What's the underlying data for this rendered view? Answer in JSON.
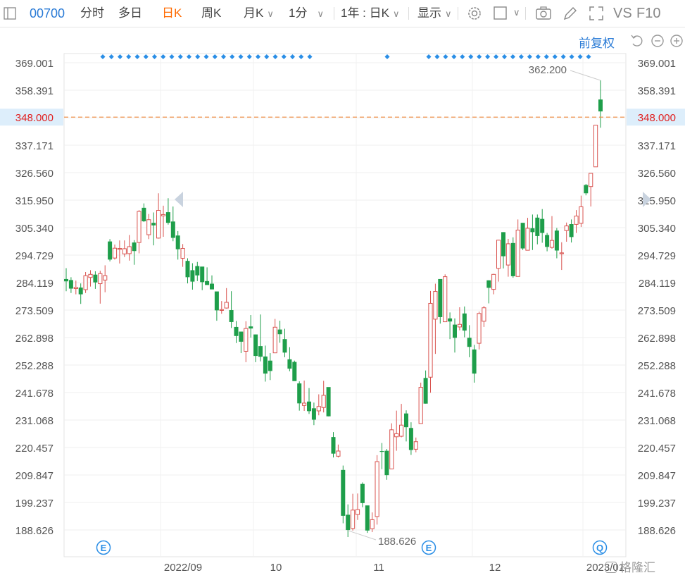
{
  "toolbar": {
    "stock_code": "00700",
    "tabs": [
      "分时",
      "多日",
      "日K",
      "周K",
      "月K",
      "1分"
    ],
    "active_tab": "日K",
    "range_select": "1年 : 日K",
    "display_select": "显示",
    "vs_label": "VS",
    "f10_label": "F10"
  },
  "adjust_label": "前复权",
  "chart_data": {
    "type": "candlestick",
    "y_ticks": [
      "369.001",
      "358.391",
      "348.000",
      "337.171",
      "326.560",
      "315.950",
      "305.340",
      "294.729",
      "284.119",
      "273.509",
      "262.898",
      "252.288",
      "241.678",
      "231.068",
      "220.457",
      "209.847",
      "199.237",
      "188.626"
    ],
    "ylim": [
      188.626,
      369.001
    ],
    "x_ticks": [
      "2022/09",
      "10",
      "11",
      "12",
      "2023/01"
    ],
    "current_price": "348.000",
    "high_label": "362.200",
    "low_label": "188.626",
    "up_color": "#d9534f",
    "down_color": "#1e9e4a",
    "current_line_color": "#f08a3c",
    "event_markers": [
      "E",
      "E",
      "Q"
    ],
    "candles": [
      [
        285.5,
        284.6,
        289.7,
        280.8
      ],
      [
        285.1,
        281.8,
        286.2,
        280.1
      ],
      [
        281.8,
        282.3,
        284.9,
        279.6
      ],
      [
        282.2,
        279.6,
        283.8,
        275.9
      ],
      [
        281.4,
        286.8,
        288.2,
        280.1
      ],
      [
        286.1,
        287.3,
        288.9,
        282.6
      ],
      [
        287.2,
        284.2,
        288.5,
        281.7
      ],
      [
        283.7,
        287.6,
        288.7,
        276.0
      ],
      [
        285.1,
        286.8,
        290.8,
        280.4
      ],
      [
        300.0,
        293.0,
        300.9,
        292.3
      ],
      [
        293.6,
        297.4,
        298.8,
        293.0
      ],
      [
        297.0,
        297.3,
        300.4,
        291.5
      ],
      [
        295.2,
        297.2,
        300.4,
        294.0
      ],
      [
        295.3,
        298.0,
        302.5,
        292.6
      ],
      [
        299.6,
        296.3,
        300.5,
        291.0
      ],
      [
        299.6,
        311.6,
        312.1,
        295.4
      ],
      [
        313.0,
        307.8,
        314.7,
        307.5
      ],
      [
        302.6,
        308.4,
        310.6,
        300.9
      ],
      [
        307.2,
        306.2,
        311.2,
        298.5
      ],
      [
        301.3,
        312.0,
        318.6,
        301.1
      ],
      [
        309.9,
        310.4,
        313.8,
        301.8
      ],
      [
        311.3,
        307.2,
        316.7,
        306.5
      ],
      [
        307.7,
        301.4,
        313.5,
        300.1
      ],
      [
        302.3,
        297.0,
        304.0,
        293.0
      ],
      [
        293.5,
        297.3,
        299.0,
        290.2
      ],
      [
        292.5,
        286.2,
        293.5,
        283.8
      ],
      [
        288.9,
        284.5,
        291.6,
        281.4
      ],
      [
        290.5,
        286.9,
        292.1,
        284.7
      ],
      [
        290.3,
        284.3,
        287.4,
        281.2
      ],
      [
        284.7,
        283.2,
        290.0,
        283.4
      ],
      [
        283.7,
        281.5,
        286.9,
        281.5
      ],
      [
        280.7,
        273.4,
        280.6,
        269.4
      ],
      [
        273.4,
        273.7,
        277.0,
        272.1
      ],
      [
        274.3,
        276.5,
        282.0,
        274.1
      ],
      [
        273.5,
        268.9,
        280.8,
        266.6
      ],
      [
        267.0,
        263.5,
        269.3,
        260.8
      ],
      [
        265.2,
        261.3,
        265.2,
        256.9
      ],
      [
        257.6,
        266.4,
        269.2,
        253.4
      ],
      [
        267.2,
        266.4,
        271.6,
        262.9
      ],
      [
        264.1,
        255.8,
        264.1,
        253.4
      ],
      [
        259.6,
        255.5,
        271.8,
        253.7
      ],
      [
        255.6,
        249.0,
        259.8,
        245.9
      ],
      [
        254.0,
        250.0,
        256.9,
        246.5
      ],
      [
        257.0,
        266.9,
        270.1,
        256.9
      ],
      [
        266.0,
        264.2,
        269.4,
        260.9
      ],
      [
        262.3,
        257.1,
        266.3,
        255.3
      ],
      [
        254.5,
        250.9,
        259.2,
        249.9
      ],
      [
        253.5,
        246.1,
        254.0,
        246.2
      ],
      [
        245.2,
        237.5,
        246.0,
        234.7
      ],
      [
        236.7,
        237.6,
        246.3,
        234.6
      ],
      [
        238.2,
        234.5,
        243.4,
        233.4
      ],
      [
        235.6,
        231.2,
        237.8,
        229.1
      ],
      [
        234.6,
        236.3,
        241.0,
        232.9
      ],
      [
        235.9,
        240.6,
        246.2,
        234.0
      ],
      [
        243.8,
        232.5,
        242.6,
        232.5
      ],
      [
        224.5,
        218.1,
        226.4,
        216.6
      ],
      [
        217.1,
        219.1,
        221.6,
        216.6
      ],
      [
        211.8,
        194.1,
        213.5,
        191.2
      ],
      [
        194.5,
        188.6,
        198.5,
        185.9
      ],
      [
        189.2,
        196.3,
        202.6,
        188.4
      ],
      [
        194.6,
        196.5,
        202.7,
        192.5
      ],
      [
        206.4,
        199.0,
        207.0,
        197.4
      ],
      [
        198.1,
        188.4,
        198.0,
        187.5
      ],
      [
        189.1,
        192.6,
        195.4,
        187.8
      ],
      [
        193.8,
        215.0,
        217.5,
        190.7
      ],
      [
        219.1,
        219.0,
        222.2,
        212.1
      ],
      [
        219.2,
        209.8,
        219.9,
        208.0
      ],
      [
        212.2,
        227.3,
        229.8,
        212.2
      ],
      [
        224.6,
        225.8,
        234.7,
        219.2
      ],
      [
        224.8,
        229.1,
        237.3,
        224.4
      ],
      [
        233.6,
        228.3,
        234.8,
        222.8
      ],
      [
        228.0,
        219.5,
        230.2,
        217.6
      ],
      [
        219.8,
        222.7,
        224.3,
        218.6
      ],
      [
        229.7,
        243.7,
        245.5,
        229.7
      ],
      [
        247.3,
        237.4,
        250.2,
        237.4
      ],
      [
        247.6,
        276.1,
        280.9,
        241.6
      ],
      [
        270.0,
        280.7,
        283.7,
        256.6
      ],
      [
        285.5,
        270.8,
        281.9,
        268.3
      ],
      [
        269.0,
        286.4,
        287.3,
        271.1
      ],
      [
        270.3,
        269.1,
        272.6,
        262.3
      ],
      [
        267.9,
        262.8,
        270.3,
        257.1
      ],
      [
        267.0,
        268.0,
        274.6,
        265.7
      ],
      [
        272.2,
        265.6,
        274.9,
        263.0
      ],
      [
        262.8,
        259.3,
        267.7,
        255.3
      ],
      [
        258.3,
        249.0,
        260.1,
        245.5
      ],
      [
        260.7,
        272.2,
        272.9,
        258.3
      ],
      [
        269.2,
        274.4,
        275.1,
        267.0
      ],
      [
        285.0,
        282.1,
        285.0,
        276.1
      ],
      [
        281.5,
        287.3,
        287.5,
        279.6
      ],
      [
        289.6,
        300.5,
        300.6,
        284.5
      ],
      [
        303.6,
        294.3,
        303.6,
        289.6
      ],
      [
        290.9,
        299.1,
        301.0,
        286.4
      ],
      [
        299.4,
        286.6,
        301.6,
        286.0
      ],
      [
        286.5,
        304.4,
        308.5,
        289.0
      ],
      [
        307.2,
        297.3,
        307.1,
        296.7
      ],
      [
        296.6,
        305.1,
        309.1,
        297.8
      ],
      [
        305.1,
        303.6,
        310.4,
        296.7
      ],
      [
        309.2,
        302.1,
        310.4,
        298.9
      ],
      [
        308.7,
        303.3,
        312.5,
        299.5
      ],
      [
        302.5,
        297.9,
        303.3,
        296.2
      ],
      [
        297.7,
        300.4,
        309.8,
        297.2
      ],
      [
        304.2,
        296.5,
        305.2,
        293.5
      ],
      [
        295.3,
        295.6,
        299.7,
        289.0
      ],
      [
        304.2,
        306.0,
        307.3,
        299.9
      ],
      [
        306.7,
        301.7,
        308.5,
        299.6
      ],
      [
        306.6,
        309.8,
        312.1,
        303.3
      ],
      [
        307.0,
        313.4,
        317.7,
        305.6
      ],
      [
        321.8,
        318.6,
        322.2,
        317.8
      ],
      [
        321.2,
        326.3,
        326.3,
        313.5
      ],
      [
        328.8,
        344.9,
        344.9,
        334.2
      ],
      [
        354.8,
        350.2,
        362.2,
        343.9
      ]
    ]
  },
  "watermark": "格隆汇"
}
